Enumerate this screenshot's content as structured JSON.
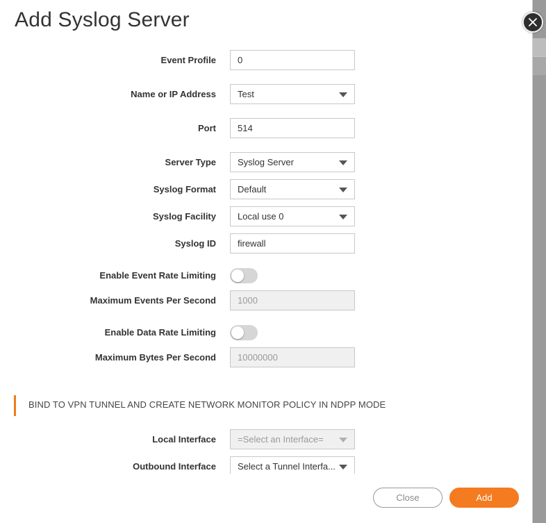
{
  "dialog": {
    "title": "Add Syslog Server",
    "close_icon": "close-icon"
  },
  "fields": {
    "event_profile": {
      "label": "Event Profile",
      "value": "0"
    },
    "name_or_ip": {
      "label": "Name or IP Address",
      "value": "Test"
    },
    "port": {
      "label": "Port",
      "value": "514"
    },
    "server_type": {
      "label": "Server Type",
      "value": "Syslog Server"
    },
    "syslog_format": {
      "label": "Syslog Format",
      "value": "Default"
    },
    "syslog_facility": {
      "label": "Syslog Facility",
      "value": "Local use 0"
    },
    "syslog_id": {
      "label": "Syslog ID",
      "value": "firewall"
    },
    "enable_event_rate_limiting": {
      "label": "Enable Event Rate Limiting",
      "enabled": false
    },
    "max_events_per_second": {
      "label": "Maximum Events Per Second",
      "value": "1000"
    },
    "enable_data_rate_limiting": {
      "label": "Enable Data Rate Limiting",
      "enabled": false
    },
    "max_bytes_per_second": {
      "label": "Maximum Bytes Per Second",
      "value": "10000000"
    }
  },
  "vpn_section": {
    "title": "BIND TO VPN TUNNEL AND CREATE NETWORK MONITOR POLICY IN NDPP MODE",
    "accent_color": "#f07c1a",
    "local_interface": {
      "label": "Local Interface",
      "value": "=Select an Interface="
    },
    "outbound_interface": {
      "label": "Outbound Interface",
      "value": "Select a Tunnel Interfa..."
    }
  },
  "buttons": {
    "close_label": "Close",
    "add_label": "Add",
    "add_color": "#f47b20"
  }
}
